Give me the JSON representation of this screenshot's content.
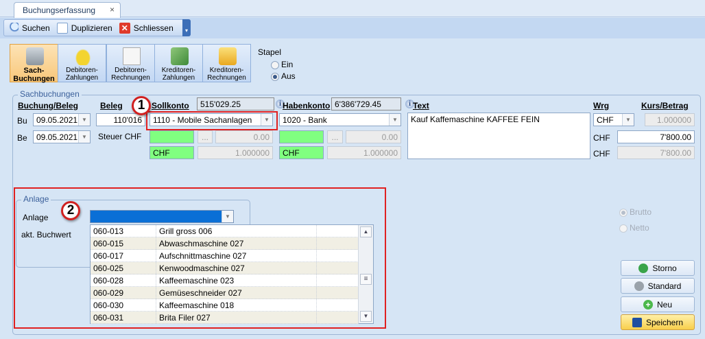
{
  "tab": {
    "title": "Buchungserfassung",
    "close": "×"
  },
  "toolbar": {
    "search": "Suchen",
    "duplicate": "Duplizieren",
    "close": "Schliessen",
    "more": "▾"
  },
  "modules": [
    {
      "l1": "Sach-",
      "l2": "Buchungen",
      "icon": "calculator-icon"
    },
    {
      "l1": "Debitoren-",
      "l2": "Zahlungen",
      "icon": "coins-icon"
    },
    {
      "l1": "Debitoren-",
      "l2": "Rechnungen",
      "icon": "invoice-icon"
    },
    {
      "l1": "Kreditoren-",
      "l2": "Zahlungen",
      "icon": "money-icon"
    },
    {
      "l1": "Kreditoren-",
      "l2": "Rechnungen",
      "icon": "basket-icon"
    }
  ],
  "stapel": {
    "label": "Stapel",
    "ein": "Ein",
    "aus": "Aus",
    "selected": "Aus"
  },
  "sach": {
    "group": "Sachbuchungen",
    "h_buchung": "Buchung/Beleg",
    "h_beleg": "Beleg",
    "h_soll": "Sollkonto",
    "soll_saldo": "515'029.25",
    "h_haben": "Habenkonto",
    "haben_saldo": "6'386'729.45",
    "h_text": "Text",
    "h_wrg": "Wrg",
    "h_kurs": "Kurs/Betrag",
    "bu": "Bu",
    "bu_date": "09.05.2021",
    "beleg": "110'016",
    "soll": "1110 - Mobile Sachanlagen",
    "haben": "1020 - Bank",
    "text": "Kauf Kaffemaschine KAFFEE FEIN",
    "wrg": "CHF",
    "kurs": "1.000000",
    "be": "Be",
    "be_date": "09.05.2021",
    "steuer": "Steuer CHF",
    "dots": "...",
    "soll_tax": "0.00",
    "haben_tax": "0.00",
    "soll_cur": "CHF",
    "soll_rate": "1.000000",
    "haben_cur": "CHF",
    "haben_rate": "1.000000",
    "cur2": "CHF",
    "betrag": "7'800.00",
    "cur3": "CHF",
    "betrag2": "7'800.00"
  },
  "callouts": {
    "one": "1",
    "two": "2"
  },
  "anlage": {
    "group": "Anlage",
    "label": "Anlage",
    "buchwert": "akt. Buchwert",
    "rows": [
      [
        "060-013",
        "Grill gross 006"
      ],
      [
        "060-015",
        "Abwaschmaschine 027"
      ],
      [
        "060-017",
        "Aufschnittmaschine 027"
      ],
      [
        "060-025",
        "Kenwoodmaschine 027"
      ],
      [
        "060-028",
        "Kaffeemaschine 023"
      ],
      [
        "060-029",
        "Gemüseschneider 027"
      ],
      [
        "060-030",
        "Kaffeemaschine 018"
      ],
      [
        "060-031",
        "Brita Filer 027"
      ]
    ]
  },
  "options": {
    "brutto": "Brutto",
    "netto": "Netto"
  },
  "buttons": {
    "storno": "Storno",
    "standard": "Standard",
    "neu": "Neu",
    "save": "Speichern"
  }
}
